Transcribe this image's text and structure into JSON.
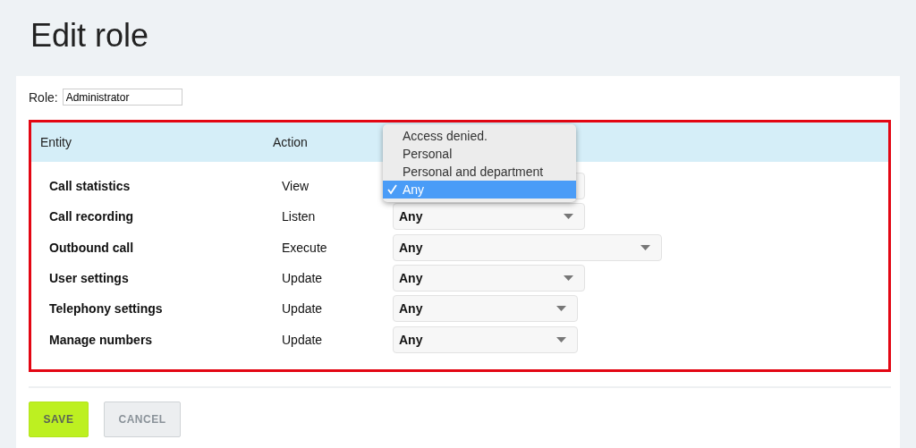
{
  "page_title": "Edit role",
  "role": {
    "label": "Role:",
    "value": "Administrator"
  },
  "table": {
    "columns": [
      "Entity",
      "Action"
    ],
    "rows": [
      {
        "entity": "Call statistics",
        "action": "View"
      },
      {
        "entity": "Call recording",
        "action": "Listen",
        "value": "Any"
      },
      {
        "entity": "Outbound call",
        "action": "Execute",
        "value": "Any"
      },
      {
        "entity": "User settings",
        "action": "Update",
        "value": "Any"
      },
      {
        "entity": "Telephony settings",
        "action": "Update",
        "value": "Any"
      },
      {
        "entity": "Manage numbers",
        "action": "Update",
        "value": "Any"
      }
    ]
  },
  "dropdown_menu": {
    "options": [
      {
        "label": "Access denied.",
        "selected": false
      },
      {
        "label": "Personal",
        "selected": false
      },
      {
        "label": "Personal and department",
        "selected": false
      },
      {
        "label": "Any",
        "selected": true
      }
    ]
  },
  "buttons": [
    {
      "label": "SAVE",
      "kind": "primary"
    },
    {
      "label": "CANCEL",
      "kind": "secondary"
    }
  ]
}
